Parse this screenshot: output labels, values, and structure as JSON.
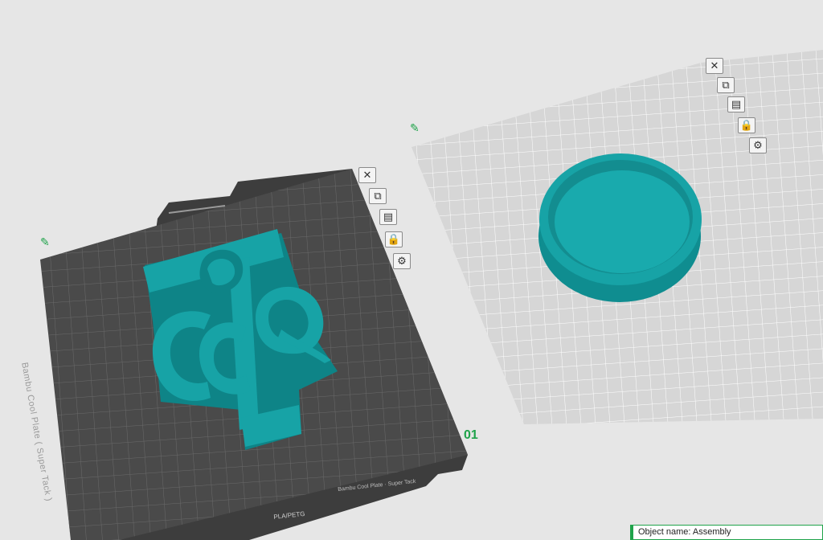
{
  "plate1": {
    "number": "01",
    "label": "Bambu Cool Plate ( Super Tack )",
    "bottom_label": "Bambu Cool Plate · Super Tack",
    "filament_tag": "PLA/PETG"
  },
  "plate_tools": [
    {
      "name": "close-icon",
      "glyph": "✕"
    },
    {
      "name": "arrange-icon",
      "glyph": "⧉"
    },
    {
      "name": "layout-icon",
      "glyph": "▤"
    },
    {
      "name": "lock-icon",
      "glyph": "🔒"
    },
    {
      "name": "settings-icon",
      "glyph": "⚙"
    }
  ],
  "colors": {
    "model": "#17a3a6",
    "plate_dark": "#4a4a4a",
    "plate_light": "#d6d6d6",
    "accent": "#1fa34a"
  },
  "object_info": {
    "text": "Object name: Assembly"
  }
}
